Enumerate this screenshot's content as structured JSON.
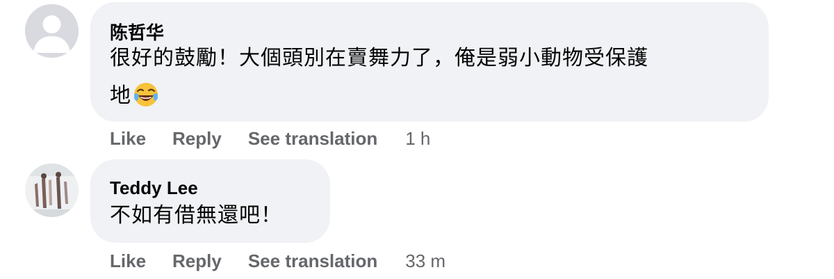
{
  "comments": [
    {
      "author": "陈哲华",
      "text_line1": "很好的鼓勵！大個頭別在賣舞力了，俺是弱小動物受保護",
      "text_line2": "地",
      "emoji": "face-with-tears-of-joy-icon",
      "avatar": "default-avatar",
      "actions": {
        "like": "Like",
        "reply": "Reply",
        "translate": "See translation",
        "time": "1 h"
      }
    },
    {
      "author": "Teddy Lee",
      "text_line1": "不如有借無還吧！",
      "avatar": "profile-photo",
      "actions": {
        "like": "Like",
        "reply": "Reply",
        "translate": "See translation",
        "time": "33 m"
      }
    }
  ],
  "colors": {
    "bubble": "#f0f2f5",
    "meta": "#65676b",
    "text": "#050505"
  }
}
